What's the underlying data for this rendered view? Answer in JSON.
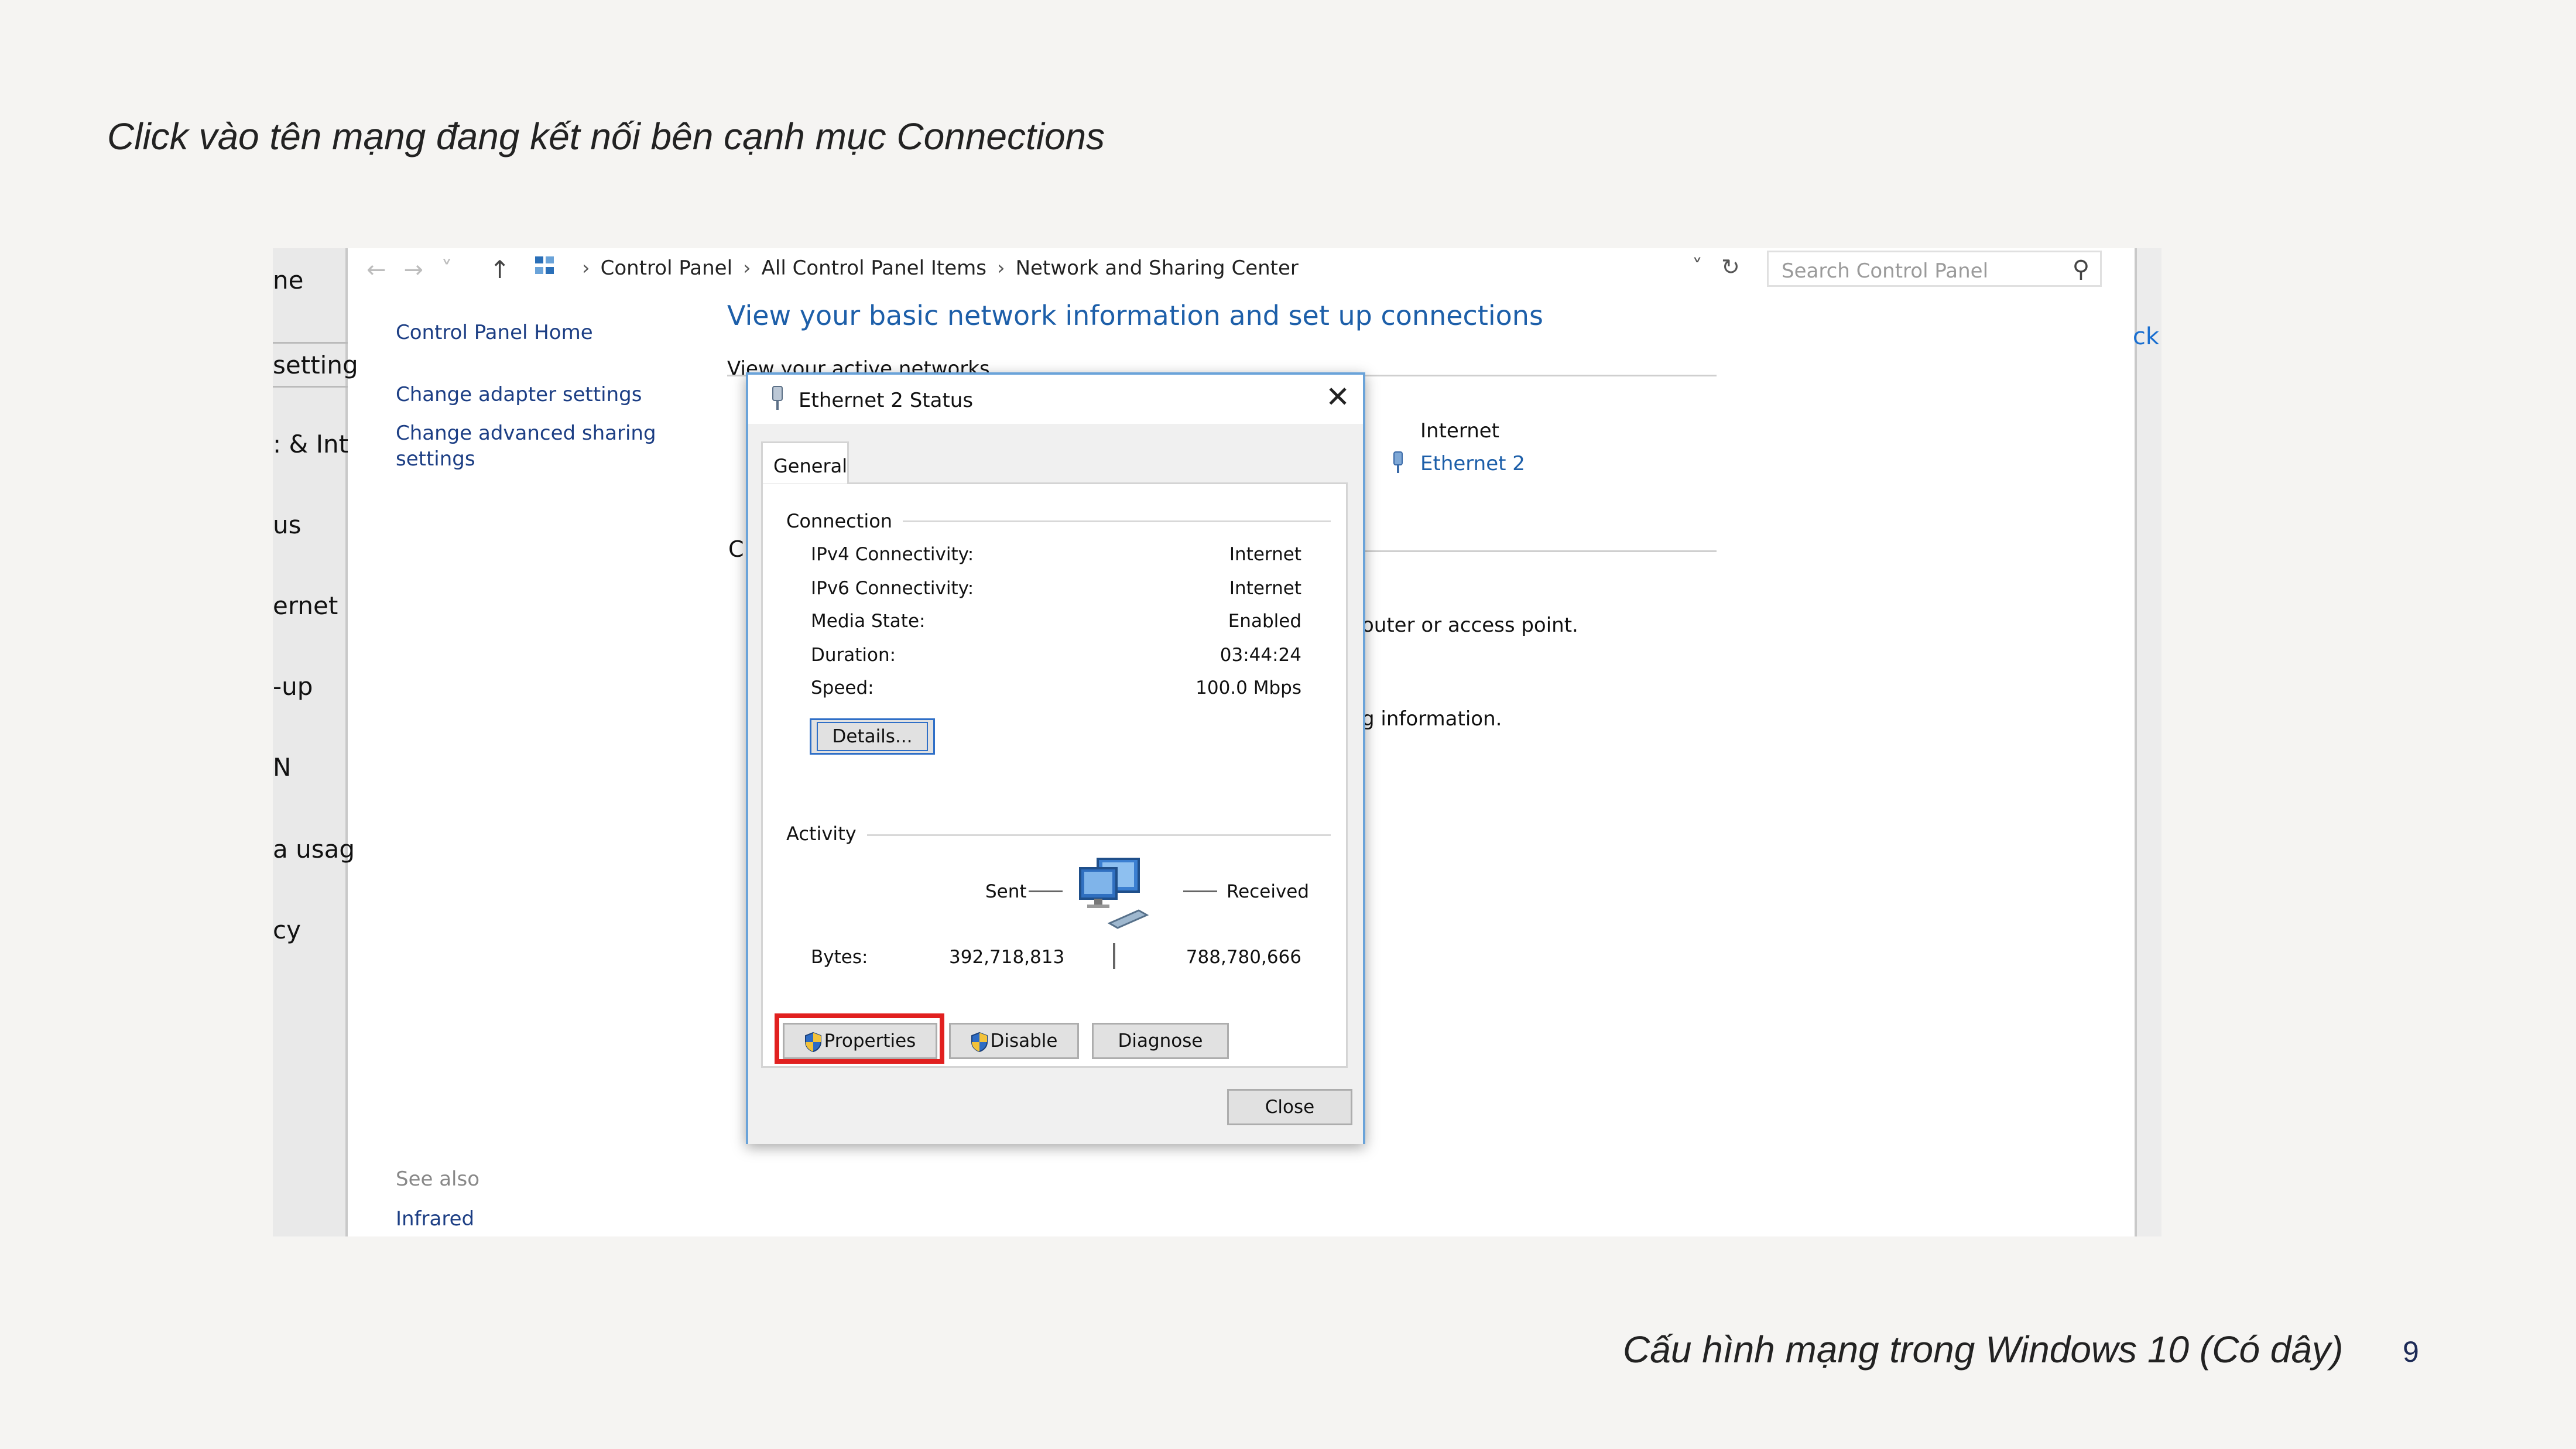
{
  "slide": {
    "title": "Click vào tên mạng đang kết nối bên cạnh mục Connections",
    "footer": "Cấu hình mạng trong Windows 10 (Có dây)",
    "page_number": "9"
  },
  "left_strip": {
    "items": [
      "ne",
      "setting",
      ": & Int",
      "us",
      "ernet",
      "-up",
      "N",
      "a usag",
      "cy"
    ]
  },
  "right_strip": {
    "link_fragment": "ck"
  },
  "address_bar": {
    "breadcrumbs": [
      "Control Panel",
      "All Control Panel Items",
      "Network and Sharing Center"
    ],
    "search_placeholder": "Search Control Panel"
  },
  "sidebar": {
    "home": "Control Panel Home",
    "change_adapter": "Change adapter settings",
    "change_sharing_line1": "Change advanced sharing",
    "change_sharing_line2": "settings",
    "see_also": "See also",
    "infrared": "Infrared"
  },
  "main": {
    "heading": "View your basic network information and set up connections",
    "view_active": "View your active networks",
    "access_type_value": "Internet",
    "connections_value": "Ethernet 2",
    "partial_router": "outer or access point.",
    "partial_info": "g information.",
    "partial_ch": "Cl"
  },
  "dialog": {
    "title": "Ethernet 2 Status",
    "tab": "General",
    "connection_group": "Connection",
    "rows": [
      {
        "label": "IPv4 Connectivity:",
        "value": "Internet"
      },
      {
        "label": "IPv6 Connectivity:",
        "value": "Internet"
      },
      {
        "label": "Media State:",
        "value": "Enabled"
      },
      {
        "label": "Duration:",
        "value": "03:44:24"
      },
      {
        "label": "Speed:",
        "value": "100.0 Mbps"
      }
    ],
    "details_button": "Details...",
    "activity_group": "Activity",
    "sent_label": "Sent",
    "received_label": "Received",
    "bytes_label": "Bytes:",
    "bytes_sent": "392,718,813",
    "bytes_received": "788,780,666",
    "properties_button": "Properties",
    "disable_button": "Disable",
    "diagnose_button": "Diagnose",
    "close_button": "Close",
    "highlight_color": "#e1201f"
  }
}
